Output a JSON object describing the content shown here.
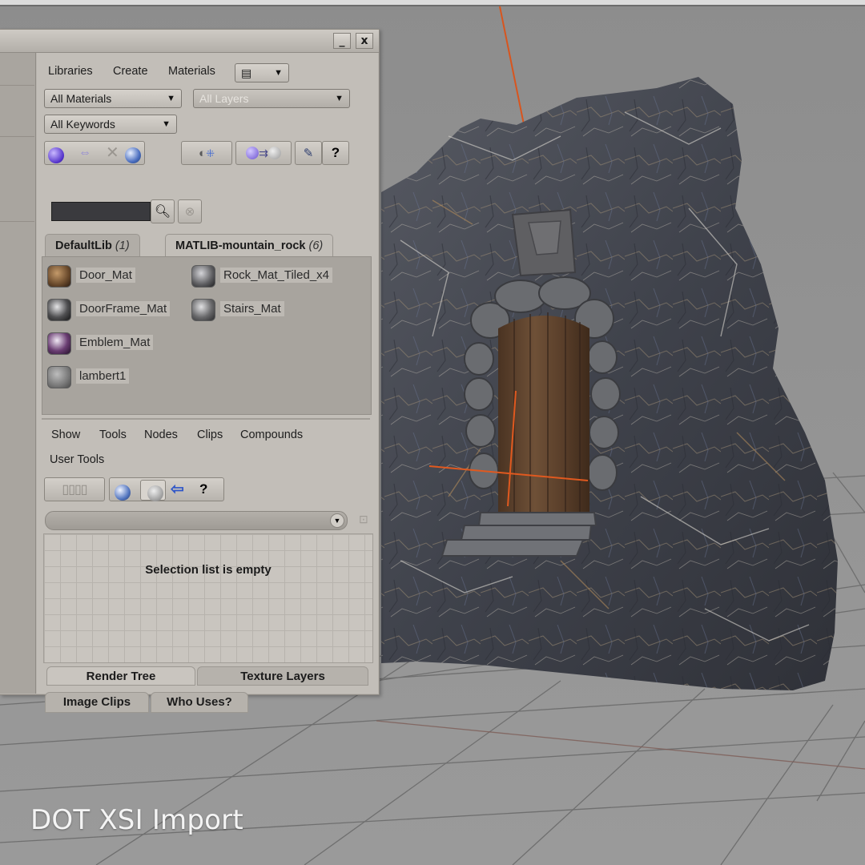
{
  "caption": "DOT XSI Import",
  "panel": {
    "minimize_label": "_",
    "close_label": "x",
    "menu": [
      "Libraries",
      "Create",
      "Materials"
    ],
    "view_dropdown": "▤",
    "filters": {
      "materials": "All Materials",
      "layers": "All Layers",
      "keywords": "All Keywords"
    },
    "toolbar_icons": [
      "sphere-icon",
      "link-icon",
      "delete-icon",
      "globe-icon",
      "assign-icon",
      "transfer-icon",
      "brush-icon",
      "help-icon"
    ],
    "help_label": "?",
    "tabs": [
      {
        "label": "DefaultLib",
        "count": "(1)"
      },
      {
        "label": "MATLIB-mountain_rock",
        "count": "(6)"
      }
    ],
    "materials": [
      {
        "name": "Door_Mat",
        "swatch": "#6a4a2c"
      },
      {
        "name": "Rock_Mat_Tiled_x4",
        "swatch": "#5d5d60"
      },
      {
        "name": "DoorFrame_Mat",
        "swatch": "#505052"
      },
      {
        "name": "Stairs_Mat",
        "swatch": "#6a6a6c"
      },
      {
        "name": "Emblem_Mat",
        "swatch": "#6a3d72"
      },
      {
        "name": "lambert1",
        "swatch": "#7a7a7a"
      }
    ],
    "render_menu": [
      "Show",
      "Tools",
      "Nodes",
      "Clips",
      "Compounds"
    ],
    "user_tools": "User Tools",
    "empty_message": "Selection list is empty",
    "bottom_tabs": [
      "Render Tree",
      "Texture Layers",
      "Image Clips",
      "Who Uses?"
    ]
  },
  "colors": {
    "panel_bg": "#c2beb8",
    "viewport_bg": "#8e8e8e",
    "axis_orange": "#d8551e"
  }
}
